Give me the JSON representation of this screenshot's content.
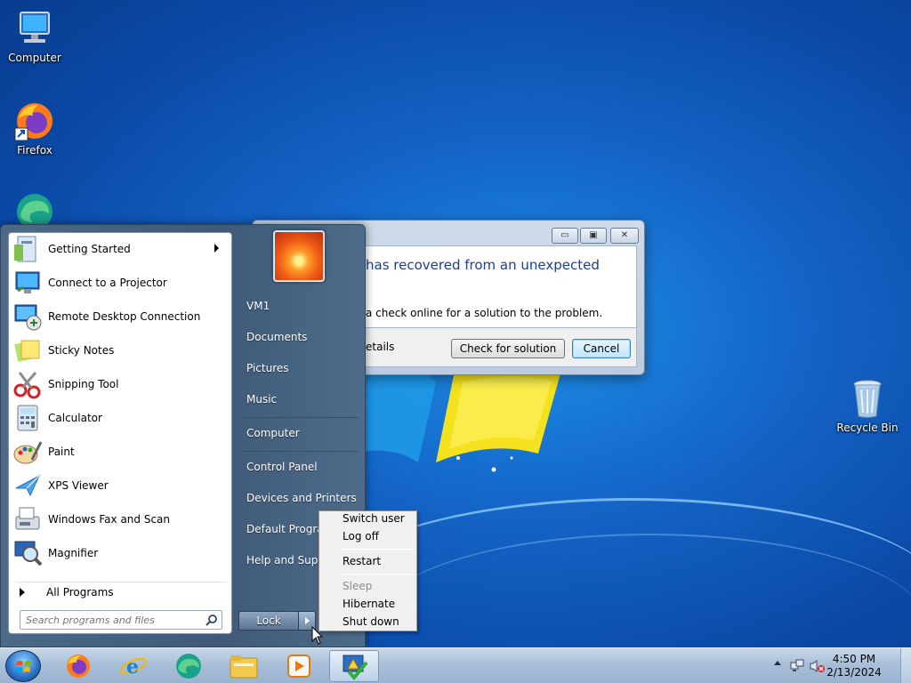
{
  "desktop": {
    "icons": [
      {
        "label": "Computer",
        "icon": "computer-icon"
      },
      {
        "label": "Firefox",
        "icon": "firefox-icon"
      },
      {
        "label": "Recycle Bin",
        "icon": "recycle-bin-icon"
      }
    ]
  },
  "dialog": {
    "title_fragment": "has recovered from an unexpected",
    "message_fragment": "a check online for a solution to the problem.",
    "details_fragment": "etails",
    "check_button": "Check for solution",
    "cancel_button": "Cancel",
    "minimize_glyph": "▭",
    "maximize_glyph": "▣",
    "close_glyph": "✕"
  },
  "start_menu": {
    "programs": [
      {
        "label": "Getting Started",
        "icon": "getting-started-icon",
        "has_submenu": true
      },
      {
        "label": "Connect to a Projector",
        "icon": "projector-icon",
        "has_submenu": false
      },
      {
        "label": "Remote Desktop Connection",
        "icon": "remote-desktop-icon",
        "has_submenu": false
      },
      {
        "label": "Sticky Notes",
        "icon": "sticky-notes-icon",
        "has_submenu": false
      },
      {
        "label": "Snipping Tool",
        "icon": "snipping-tool-icon",
        "has_submenu": false
      },
      {
        "label": "Calculator",
        "icon": "calculator-icon",
        "has_submenu": false
      },
      {
        "label": "Paint",
        "icon": "paint-icon",
        "has_submenu": false
      },
      {
        "label": "XPS Viewer",
        "icon": "xps-viewer-icon",
        "has_submenu": false
      },
      {
        "label": "Windows Fax and Scan",
        "icon": "fax-scan-icon",
        "has_submenu": false
      },
      {
        "label": "Magnifier",
        "icon": "magnifier-icon",
        "has_submenu": false
      }
    ],
    "all_programs": "All Programs",
    "search_placeholder": "Search programs and files",
    "right_items": [
      "VM1",
      "Documents",
      "Pictures",
      "Music",
      "Computer",
      "Control Panel",
      "Devices and Printers",
      "Default Programs",
      "Help and Support"
    ],
    "lock_button": "Lock"
  },
  "power_menu": {
    "items": [
      {
        "label": "Switch user",
        "enabled": true
      },
      {
        "label": "Log off",
        "enabled": true
      },
      {
        "label": "Restart",
        "enabled": true
      },
      {
        "label": "Sleep",
        "enabled": false
      },
      {
        "label": "Hibernate",
        "enabled": true
      },
      {
        "label": "Shut down",
        "enabled": true
      }
    ]
  },
  "taskbar": {
    "pinned": [
      "firefox-icon",
      "internet-explorer-icon",
      "edge-icon",
      "file-explorer-icon",
      "media-player-icon",
      "action-center-app-icon"
    ],
    "clock_time": "4:50 PM",
    "clock_date": "2/13/2024",
    "tray_icons": [
      "show-hidden-icons-icon",
      "network-icon",
      "volume-muted-icon"
    ]
  },
  "colors": {
    "desktop_bg": "#1466c8",
    "start_menu_bg": "#3e5a78",
    "taskbar_bg": "#a9bfd8"
  }
}
